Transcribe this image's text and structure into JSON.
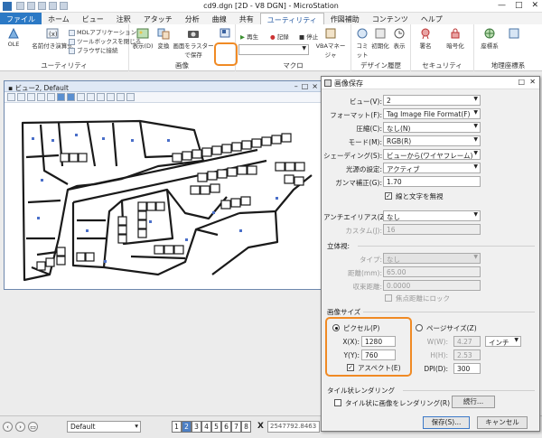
{
  "titlebar": {
    "file_label": "ファイル",
    "title": "cd9.dgn [2D - V8 DGN] - MicroStation",
    "window_buttons": [
      "—",
      "□",
      "✕"
    ]
  },
  "ribbon_tabs": [
    "ホーム",
    "ビュー",
    "注釈",
    "アタッチ",
    "分析",
    "曲線",
    "共有",
    "ユーティリティ",
    "作図補助",
    "コンテンツ",
    "ヘルプ"
  ],
  "active_tab": "ユーティリティ",
  "ribbon": {
    "utility": {
      "group_label": "ユーティリティ",
      "ole": "OLE",
      "named_expr": "名前付き演算式",
      "mdl_app": "MDLアプリケーション",
      "toolbox_close": "ツールボックスを閉じる",
      "browser_link": "ブラウザに接続"
    },
    "image": {
      "group_label": "画像",
      "display": "表示(D)",
      "convert": "変換",
      "raster_screen": "画面をラスターで保存"
    },
    "macro": {
      "group_label": "マクロ",
      "play": "再生",
      "record": "記録",
      "stop": "停止",
      "vba_manager": "VBAマネージャ"
    },
    "design_history": {
      "group_label": "デザイン履歴",
      "commit": "コミット",
      "init": "初期化",
      "show": "表示"
    },
    "security": {
      "group_label": "セキュリティ",
      "sign": "署名",
      "encrypt": "暗号化"
    },
    "geo": {
      "group_label": "地理座標系",
      "coordinate_system": "座標系"
    }
  },
  "view_window": {
    "title": "ビュー2, Default"
  },
  "dialog": {
    "title": "画像保存",
    "view_label": "ビュー(V):",
    "view_value": "2",
    "format_label": "フォーマット(F):",
    "format_value": "Tag Image File Format(F)",
    "compression_label": "圧縮(C):",
    "compression_value": "なし(N)",
    "mode_label": "モード(M):",
    "mode_value": "RGB(R)",
    "shading_label": "シェーディング(S):",
    "shading_value": "ビューから(ワイヤフレーム)",
    "lighting_label": "光源の設定:",
    "lighting_value": "アクティブ",
    "gamma_label": "ガンマ補正(G):",
    "gamma_value": "1.70",
    "lines_text_label": "線と文字を無視",
    "antialias_label": "アンチエイリアス(Z):",
    "antialias_value": "なし",
    "custom_label": "カスタム(J):",
    "custom_value": "16",
    "stereo_section": "立体視:",
    "stereo_type_label": "タイプ:",
    "stereo_type_value": "なし",
    "stereo_distance_label": "距離(mm):",
    "stereo_distance_value": "65.00",
    "focus_distance_label": "収束距離:",
    "focus_distance_value": "0.0000",
    "focus_lock_label": "焦点距離にロック",
    "image_size_section": "画像サイズ",
    "pixels_label": "ピクセル(P)",
    "x_label": "X(X):",
    "x_value": "1280",
    "y_label": "Y(Y):",
    "y_value": "760",
    "aspect_label": "アスペクト(E)",
    "page_size_label": "ページサイズ(Z)",
    "w_label": "W(W):",
    "w_value": "4.27",
    "unit_value": "インチ",
    "h_label": "H(H):",
    "h_value": "2.53",
    "dpi_label": "DPI(D):",
    "dpi_value": "300",
    "tile_section": "タイル状レンダリング",
    "tile_render_label": "タイル状に画像をレンダリング(R)",
    "continue_button": "続行...",
    "save_button": "保存(S)...",
    "cancel_button": "キャンセル"
  },
  "statusbar": {
    "level": "Default",
    "view_numbers": [
      "1",
      "2",
      "3",
      "4",
      "5",
      "6",
      "7",
      "8"
    ],
    "active_view": "2",
    "x_label": "X",
    "x_value": "2547792.8463"
  },
  "accent_colors": {
    "highlight": "#f08a24",
    "file_tab": "#2b79c5"
  }
}
